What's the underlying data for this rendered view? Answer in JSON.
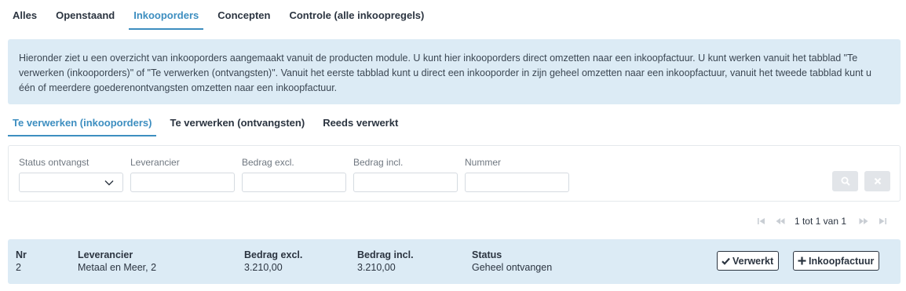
{
  "top_tabs": [
    {
      "label": "Alles"
    },
    {
      "label": "Openstaand"
    },
    {
      "label": "Inkooporders"
    },
    {
      "label": "Concepten"
    },
    {
      "label": "Controle (alle inkoopregels)"
    }
  ],
  "active_top_tab": "Inkooporders",
  "info": {
    "text": "Hieronder ziet u een overzicht van inkooporders aangemaakt vanuit de producten module. U kunt hier inkooporders direct omzetten naar een inkoopfactuur. U kunt werken vanuit het tabblad \"Te verwerken (inkooporders)\" of \"Te verwerken (ontvangsten)\". Vanuit het eerste tabblad kunt u direct een inkooporder in zijn geheel omzetten naar een inkoopfactuur, vanuit het tweede tabblad kunt u één of meerdere goederenontvangsten omzetten naar een inkoopfactuur."
  },
  "sub_tabs": [
    {
      "label": "Te verwerken (inkooporders)"
    },
    {
      "label": "Te verwerken (ontvangsten)"
    },
    {
      "label": "Reeds verwerkt"
    }
  ],
  "active_sub_tab": "Te verwerken (inkooporders)",
  "filters": {
    "status_label": "Status ontvangst",
    "status_value": "",
    "leverancier_label": "Leverancier",
    "leverancier_value": "",
    "bedrag_excl_label": "Bedrag excl.",
    "bedrag_excl_value": "",
    "bedrag_incl_label": "Bedrag incl.",
    "bedrag_incl_value": "",
    "nummer_label": "Nummer",
    "nummer_value": ""
  },
  "icons": {
    "search": "search-icon",
    "clear": "close-icon",
    "first": "first-page-icon",
    "prev": "previous-page-icon",
    "next": "next-page-icon",
    "last": "last-page-icon",
    "check": "check-icon",
    "plus": "plus-icon"
  },
  "pager": {
    "text": "1 tot 1 van 1"
  },
  "columns": {
    "nr": "Nr",
    "leverancier": "Leverancier",
    "bedrag_excl": "Bedrag excl.",
    "bedrag_incl": "Bedrag incl.",
    "status": "Status"
  },
  "rows": [
    {
      "nr": "2",
      "leverancier": "Metaal en Meer, 2",
      "bedrag_excl": "3.210,00",
      "bedrag_incl": "3.210,00",
      "status": "Geheel ontvangen"
    }
  ],
  "actions": {
    "verwerkt": "Verwerkt",
    "inkoopfactuur": "Inkoopfactuur"
  },
  "colors": {
    "accent": "#3d8ec0",
    "info_bg": "#dcebf5",
    "text": "#2b3440"
  }
}
